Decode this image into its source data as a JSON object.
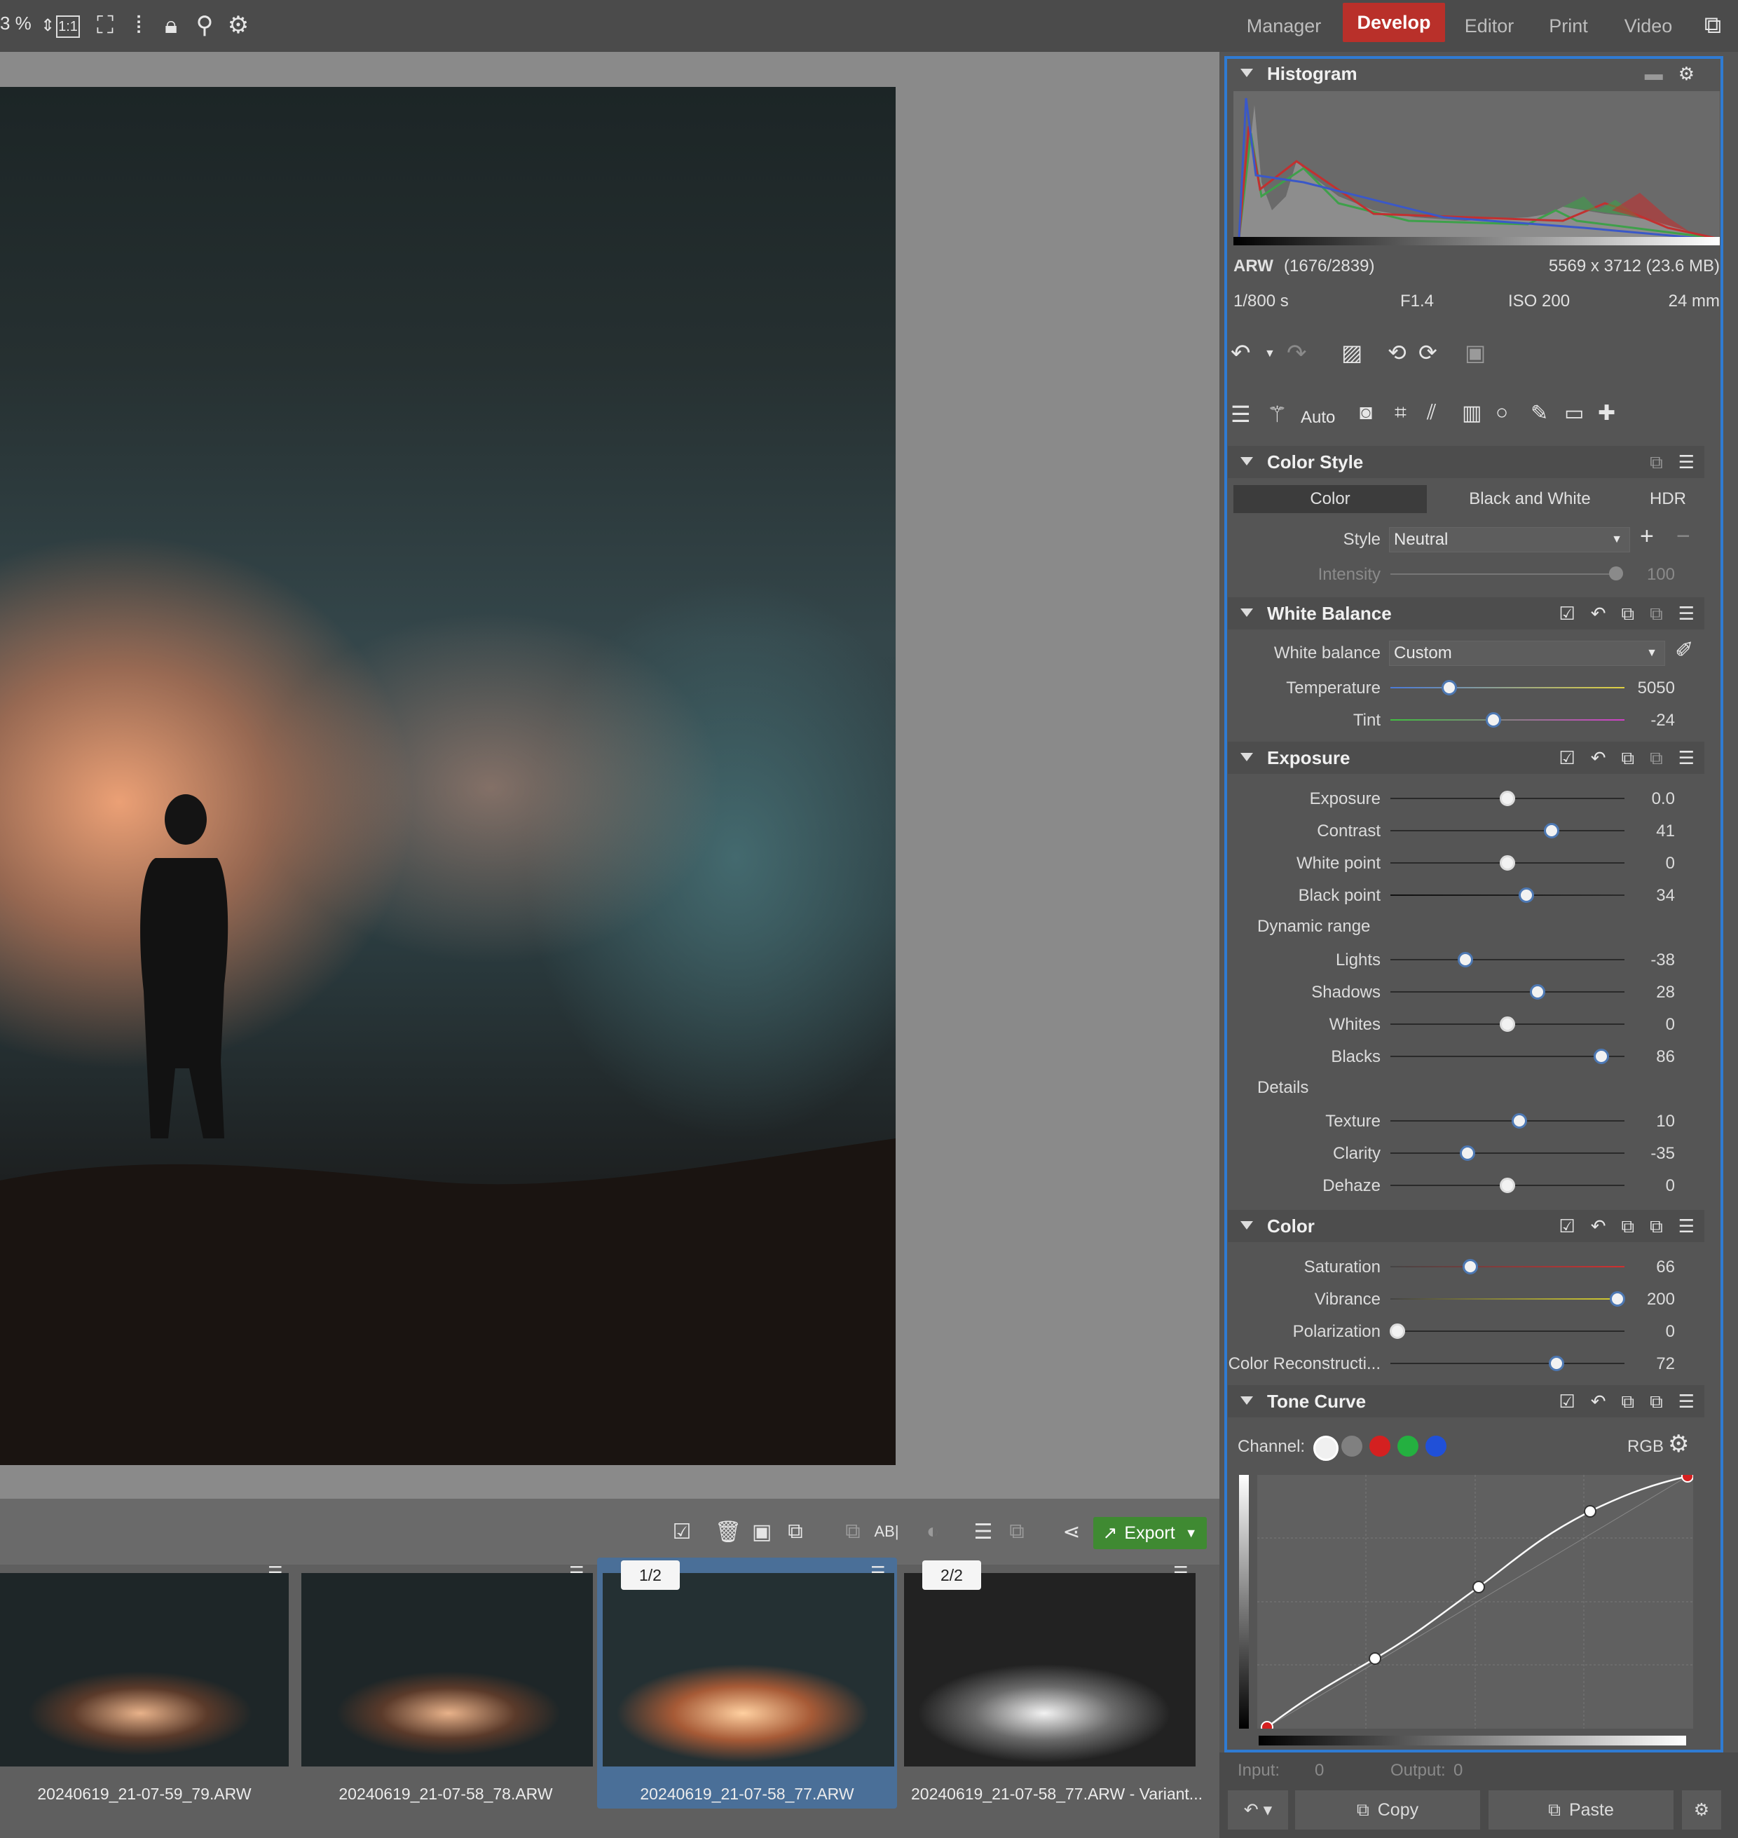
{
  "toolbar": {
    "zoom_value": "3 %",
    "icons": [
      "zoom-stepper",
      "one-to-one",
      "fit-screen",
      "fill-screen",
      "lock",
      "compare",
      "preview-settings"
    ]
  },
  "nav": {
    "tabs": [
      "Manager",
      "Develop",
      "Editor",
      "Print",
      "Video"
    ],
    "active": "Develop"
  },
  "filmstrip": {
    "export_label": "Export",
    "items": [
      {
        "label": "20240619_21-07-59_79.ARW",
        "badge": ""
      },
      {
        "label": "20240619_21-07-58_78.ARW",
        "badge": ""
      },
      {
        "label": "20240619_21-07-58_77.ARW",
        "badge": "1/2",
        "selected": true
      },
      {
        "label": "20240619_21-07-58_77.ARW - Variant...",
        "badge": "2/2"
      }
    ]
  },
  "histogram": {
    "title": "Histogram",
    "format": "ARW",
    "index": "(1676/2839)",
    "dimensions": "5569 x 3712 (23.6 MB)",
    "shutter": "1/800 s",
    "aperture": "F1.4",
    "iso": "ISO 200",
    "focal": "24 mm"
  },
  "tools": {
    "auto_label": "Auto"
  },
  "color_style": {
    "title": "Color Style",
    "tabs": [
      "Color",
      "Black and White",
      "HDR"
    ],
    "active_tab": "Color",
    "style_label": "Style",
    "style_value": "Neutral",
    "intensity_label": "Intensity",
    "intensity_value": "100"
  },
  "white_balance": {
    "title": "White Balance",
    "wb_label": "White balance",
    "wb_value": "Custom",
    "sliders": [
      {
        "label": "Temperature",
        "value": "5050",
        "pos": 0.25
      },
      {
        "label": "Tint",
        "value": "-24",
        "pos": 0.44
      }
    ]
  },
  "exposure": {
    "title": "Exposure",
    "sliders": [
      {
        "label": "Exposure",
        "value": "0.0",
        "pos": 0.5
      },
      {
        "label": "Contrast",
        "value": "41",
        "pos": 0.69
      },
      {
        "label": "White point",
        "value": "0",
        "pos": 0.5
      },
      {
        "label": "Black point",
        "value": "34",
        "pos": 0.58
      }
    ],
    "dynamic_range_label": "Dynamic range",
    "dynamic_range": [
      {
        "label": "Lights",
        "value": "-38",
        "pos": 0.32
      },
      {
        "label": "Shadows",
        "value": "28",
        "pos": 0.63
      },
      {
        "label": "Whites",
        "value": "0",
        "pos": 0.5
      },
      {
        "label": "Blacks",
        "value": "86",
        "pos": 0.9
      }
    ],
    "details_label": "Details",
    "details": [
      {
        "label": "Texture",
        "value": "10",
        "pos": 0.55
      },
      {
        "label": "Clarity",
        "value": "-35",
        "pos": 0.33
      },
      {
        "label": "Dehaze",
        "value": "0",
        "pos": 0.5
      }
    ]
  },
  "color": {
    "title": "Color",
    "sliders": [
      {
        "label": "Saturation",
        "value": "66",
        "pos": 0.34
      },
      {
        "label": "Vibrance",
        "value": "200",
        "pos": 0.97
      },
      {
        "label": "Polarization",
        "value": "0",
        "pos": 0.03
      },
      {
        "label": "Color Reconstructi...",
        "value": "72",
        "pos": 0.71
      }
    ]
  },
  "tone_curve": {
    "title": "Tone Curve",
    "channel_label": "Channel:",
    "channel_mode": "RGB",
    "channel_colors": [
      "#f0f0f0",
      "#808080",
      "#d42020",
      "#24b040",
      "#2050d8"
    ],
    "input_label": "Input:",
    "input_value": "0",
    "output_label": "Output:",
    "output_value": "0"
  },
  "bottom": {
    "copy_label": "Copy",
    "paste_label": "Paste"
  },
  "colors": {
    "accent": "#b9302a",
    "panel_border": "#2f7bd3",
    "export": "#3f8a32"
  }
}
